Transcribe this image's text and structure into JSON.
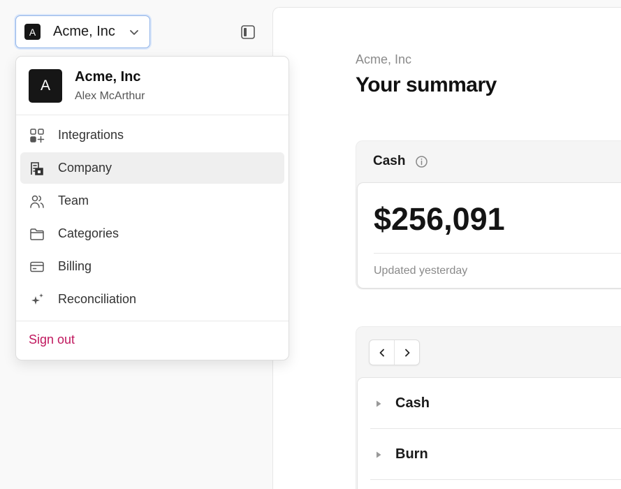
{
  "org_switcher": {
    "avatar_letter": "A",
    "name": "Acme, Inc"
  },
  "dropdown": {
    "avatar_letter": "A",
    "org_name": "Acme, Inc",
    "user_name": "Alex McArthur",
    "items": [
      {
        "label": "Integrations",
        "icon": "integrations-icon",
        "active": false
      },
      {
        "label": "Company",
        "icon": "building-icon",
        "active": true
      },
      {
        "label": "Team",
        "icon": "users-icon",
        "active": false
      },
      {
        "label": "Categories",
        "icon": "folder-icon",
        "active": false
      },
      {
        "label": "Billing",
        "icon": "credit-card-icon",
        "active": false
      },
      {
        "label": "Reconciliation",
        "icon": "sparkles-icon",
        "active": false
      }
    ],
    "sign_out": "Sign out"
  },
  "main": {
    "breadcrumb": "Acme, Inc",
    "title": "Your summary",
    "cash": {
      "label": "Cash",
      "amount": "$256,091",
      "updated": "Updated yesterday"
    },
    "rows": [
      {
        "label": "Cash"
      },
      {
        "label": "Burn"
      }
    ]
  },
  "colors": {
    "accent_focus": "#8fb3e8",
    "sign_out": "#c0185e",
    "avatar_bg": "#161616"
  }
}
